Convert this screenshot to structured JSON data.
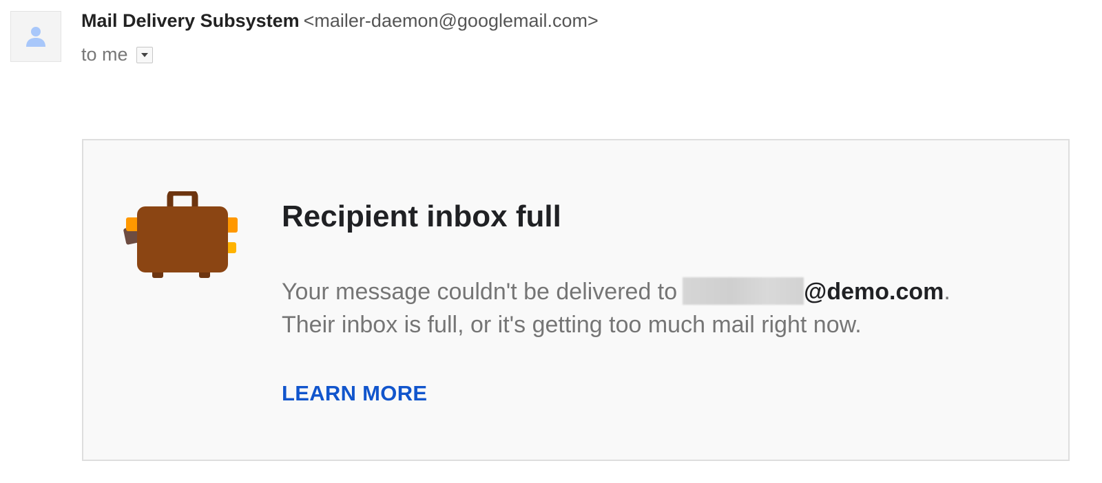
{
  "sender": {
    "name": "Mail Delivery Subsystem",
    "email": "<mailer-daemon@googlemail.com>"
  },
  "recipient": {
    "text": "to me"
  },
  "icons": {
    "avatar": "person-icon",
    "details_toggle": "dropdown-arrow-icon",
    "illustration": "suitcase-icon"
  },
  "card": {
    "title": "Recipient inbox full",
    "body_prefix": "Your message couldn't be delivered to",
    "recipient_domain": "@demo.com",
    "body_suffix": ".",
    "body_line2": "Their inbox is full, or it's getting too much mail right now.",
    "learn_more": "LEARN MORE"
  },
  "colors": {
    "link": "#1155cc",
    "suitcase": "#8b4513",
    "suitcase_strap": "#f5a623",
    "avatar_icon": "#a8c7fa"
  }
}
